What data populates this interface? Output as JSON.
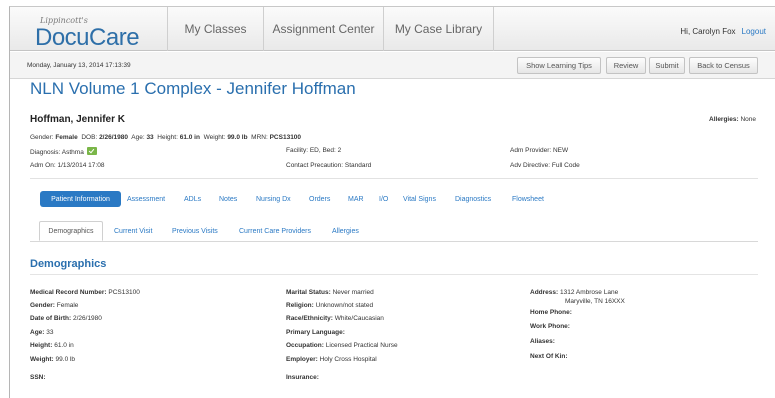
{
  "header": {
    "logo_small": "Lippincott's",
    "logo_main": "DocuCare",
    "tabs": [
      "My Classes",
      "Assignment Center",
      "My Case Library"
    ],
    "user_greeting": "Hi, Carolyn Fox",
    "logout": "Logout"
  },
  "subbar": {
    "datetime": "Monday, January 13, 2014 17:13:39",
    "buttons": [
      "Show Learning Tips",
      "Review",
      "Submit",
      "Back to Census"
    ]
  },
  "page_title": "NLN Volume 1 Complex - Jennifer Hoffman",
  "patient": {
    "name": "Hoffman, Jennifer K",
    "allergies_label": "Allergies:",
    "allergies_value": "None",
    "gender_label": "Gender:",
    "gender": "Female",
    "dob_label": "DOB:",
    "dob": "2/26/1980",
    "age_label": "Age:",
    "age": "33",
    "height_label": "Height:",
    "height": "61.0 in",
    "weight_label": "Weight:",
    "weight": "99.0 lb",
    "mrn_label": "MRN:",
    "mrn": "PCS13100",
    "diagnosis": "Diagnosis: Asthma",
    "facility": "Facility: ED, Bed: 2",
    "adm_provider": "Adm Provider: NEW",
    "adm_on": "Adm On: 1/13/2014 17:08",
    "contact_precaution": "Contact Precaution: Standard",
    "adv_directive": "Adv Directive: Full Code"
  },
  "main_tabs": [
    "Patient Information",
    "Assessment",
    "ADLs",
    "Notes",
    "Nursing Dx",
    "Orders",
    "MAR",
    "I/O",
    "Vital Signs",
    "Diagnostics",
    "Flowsheet"
  ],
  "sub_tabs": [
    "Demographics",
    "Current Visit",
    "Previous Visits",
    "Current Care Providers",
    "Allergies"
  ],
  "section_title": "Demographics",
  "demographics": {
    "col1": [
      {
        "label": "Medical Record Number:",
        "value": "PCS13100"
      },
      {
        "label": "Gender:",
        "value": "Female"
      },
      {
        "label": "Date of Birth:",
        "value": "2/26/1980"
      },
      {
        "label": "Age:",
        "value": "33"
      },
      {
        "label": "Height:",
        "value": "61.0 in"
      },
      {
        "label": "Weight:",
        "value": "99.0 lb"
      },
      {
        "label": "SSN:",
        "value": ""
      }
    ],
    "col2": [
      {
        "label": "Marital Status:",
        "value": "Never married"
      },
      {
        "label": "Religion:",
        "value": "Unknown/not stated"
      },
      {
        "label": "Race/Ethnicity:",
        "value": "White/Caucasian"
      },
      {
        "label": "Primary Language:",
        "value": ""
      },
      {
        "label": "Occupation:",
        "value": "Licensed Practical Nurse"
      },
      {
        "label": "Employer:",
        "value": "Holy Cross Hospital"
      },
      {
        "label": "Insurance:",
        "value": ""
      }
    ],
    "col3": [
      {
        "label": "Address:",
        "value": "1312 Ambrose Lane"
      },
      {
        "label": "",
        "value": "Maryville, TN 16XXX"
      },
      {
        "label": "Home Phone:",
        "value": ""
      },
      {
        "label": "Work Phone:",
        "value": ""
      },
      {
        "label": "Aliases:",
        "value": ""
      },
      {
        "label": "Next Of Kin:",
        "value": ""
      }
    ]
  }
}
